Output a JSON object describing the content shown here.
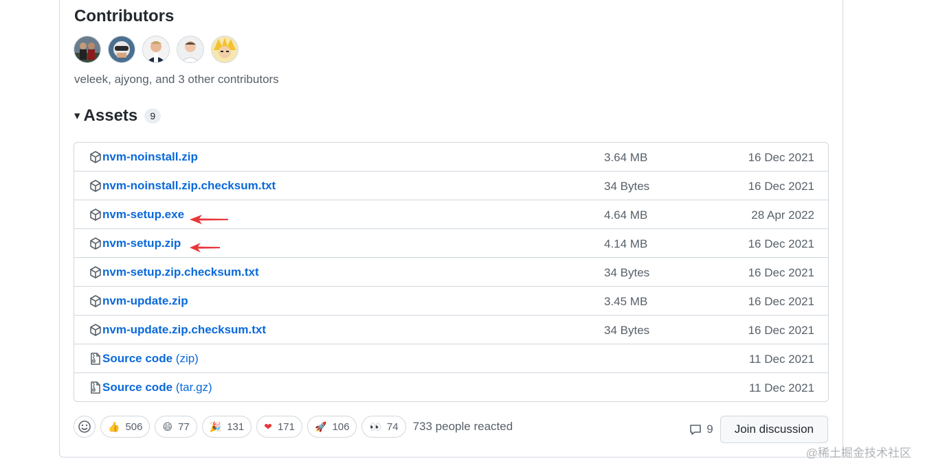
{
  "contributors": {
    "title": "Contributors",
    "summary": "veleek, ajyong, and 3 other contributors",
    "avatars": [
      "veleek",
      "ajyong",
      "contributor-3",
      "contributor-4",
      "contributor-5"
    ]
  },
  "assets": {
    "caret": "▾",
    "title": "Assets",
    "count": "9",
    "items": [
      {
        "name": "nvm-noinstall.zip",
        "sub": "",
        "size": "3.64 MB",
        "date": "16 Dec 2021",
        "icon": "package-icon"
      },
      {
        "name": "nvm-noinstall.zip.checksum.txt",
        "sub": "",
        "size": "34 Bytes",
        "date": "16 Dec 2021",
        "icon": "package-icon"
      },
      {
        "name": "nvm-setup.exe",
        "sub": "",
        "size": "4.64 MB",
        "date": "28 Apr 2022",
        "icon": "package-icon"
      },
      {
        "name": "nvm-setup.zip",
        "sub": "",
        "size": "4.14 MB",
        "date": "16 Dec 2021",
        "icon": "package-icon"
      },
      {
        "name": "nvm-setup.zip.checksum.txt",
        "sub": "",
        "size": "34 Bytes",
        "date": "16 Dec 2021",
        "icon": "package-icon"
      },
      {
        "name": "nvm-update.zip",
        "sub": "",
        "size": "3.45 MB",
        "date": "16 Dec 2021",
        "icon": "package-icon"
      },
      {
        "name": "nvm-update.zip.checksum.txt",
        "sub": "",
        "size": "34 Bytes",
        "date": "16 Dec 2021",
        "icon": "package-icon"
      },
      {
        "name": "Source code",
        "sub": "(zip)",
        "size": "",
        "date": "11 Dec 2021",
        "icon": "file-zip-icon"
      },
      {
        "name": "Source code",
        "sub": "(tar.gz)",
        "size": "",
        "date": "11 Dec 2021",
        "icon": "file-zip-icon"
      }
    ]
  },
  "reactions": {
    "items": [
      {
        "emoji": "👍",
        "count": "506",
        "name": "thumbs-up"
      },
      {
        "emoji": "😄",
        "count": "77",
        "name": "laugh"
      },
      {
        "emoji": "🎉",
        "count": "131",
        "name": "hooray"
      },
      {
        "emoji": "❤",
        "count": "171",
        "name": "heart"
      },
      {
        "emoji": "🚀",
        "count": "106",
        "name": "rocket"
      },
      {
        "emoji": "👀",
        "count": "74",
        "name": "eyes"
      }
    ],
    "summary": "733 people reacted"
  },
  "discussion": {
    "comment_count": "9",
    "join_label": "Join discussion"
  },
  "watermark": "@稀土掘金技术社区",
  "colors": {
    "link": "#0969da",
    "arrow": "#e8363a",
    "border": "#d0d7de",
    "muted": "#57606a"
  }
}
